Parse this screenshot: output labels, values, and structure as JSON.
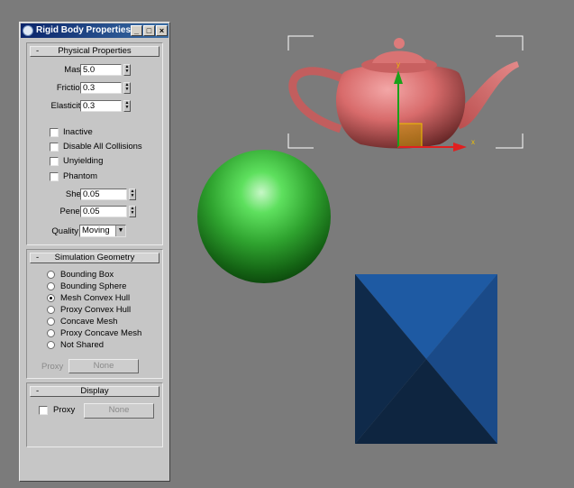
{
  "window": {
    "title": "Rigid Body Properties",
    "controls": {
      "minimize": "_",
      "maximize": "□",
      "close": "×"
    }
  },
  "physical": {
    "header": "Physical Properties",
    "collapse_symbol": "-",
    "mass": {
      "label": "Mass",
      "value": "5.0"
    },
    "friction": {
      "label": "Friction",
      "value": "0.3"
    },
    "elasticity": {
      "label": "Elasticity",
      "value": "0.3"
    },
    "checkboxes": [
      {
        "label": "Inactive",
        "checked": false
      },
      {
        "label": "Disable All Collisions",
        "checked": false
      },
      {
        "label": "Unyielding",
        "checked": false
      },
      {
        "label": "Phantom",
        "checked": false
      }
    ],
    "shell": {
      "label": "Shell",
      "value": "0.05"
    },
    "penet": {
      "label": "Penet.",
      "value": "0.05"
    },
    "quality": {
      "label": "Quality",
      "value": "Moving"
    }
  },
  "geometry": {
    "header": "Simulation Geometry",
    "collapse_symbol": "-",
    "options": [
      {
        "label": "Bounding Box",
        "selected": false
      },
      {
        "label": "Bounding Sphere",
        "selected": false
      },
      {
        "label": "Mesh Convex Hull",
        "selected": true
      },
      {
        "label": "Proxy Convex Hull",
        "selected": false
      },
      {
        "label": "Concave Mesh",
        "selected": false
      },
      {
        "label": "Proxy Concave Mesh",
        "selected": false
      },
      {
        "label": "Not Shared",
        "selected": false
      }
    ],
    "proxy_label": "Proxy",
    "proxy_button": "None"
  },
  "display": {
    "header": "Display",
    "collapse_symbol": "-",
    "proxy_label": "Proxy",
    "proxy_checked": false,
    "proxy_button": "None"
  },
  "scene": {
    "objects": [
      "teapot",
      "sphere",
      "box"
    ],
    "gizmo_axes": {
      "x": "x",
      "y": "y"
    },
    "colors": {
      "background": "#7b7b7b",
      "teapot": "#d86b6b",
      "sphere": "#3fc43f",
      "box": "#1b4f8f",
      "selection": "#ffffff"
    }
  }
}
